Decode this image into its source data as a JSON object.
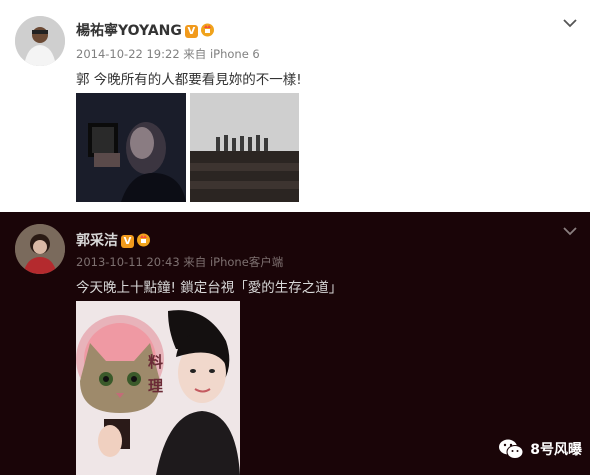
{
  "posts": [
    {
      "author": "楊祐寧YOYANG",
      "timestamp": "2014-10-22 19:22",
      "source_prefix": "来自",
      "source": "iPhone 6",
      "text": "郭 今晚所有的人都要看見妳的不一樣!"
    },
    {
      "author": "郭采洁",
      "timestamp": "2013-10-11 20:43",
      "source_prefix": "来自",
      "source": "iPhone客户端",
      "text": "今天晚上十點鐘! 鎖定台視「愛的生存之道」"
    }
  ],
  "badges": {
    "verified": "V"
  },
  "watermark": {
    "label": "8号风曝"
  },
  "colors": {
    "post2_bg": "#1a0508",
    "badge_orange": "#f19a1c",
    "meta_gray": "#808080"
  }
}
